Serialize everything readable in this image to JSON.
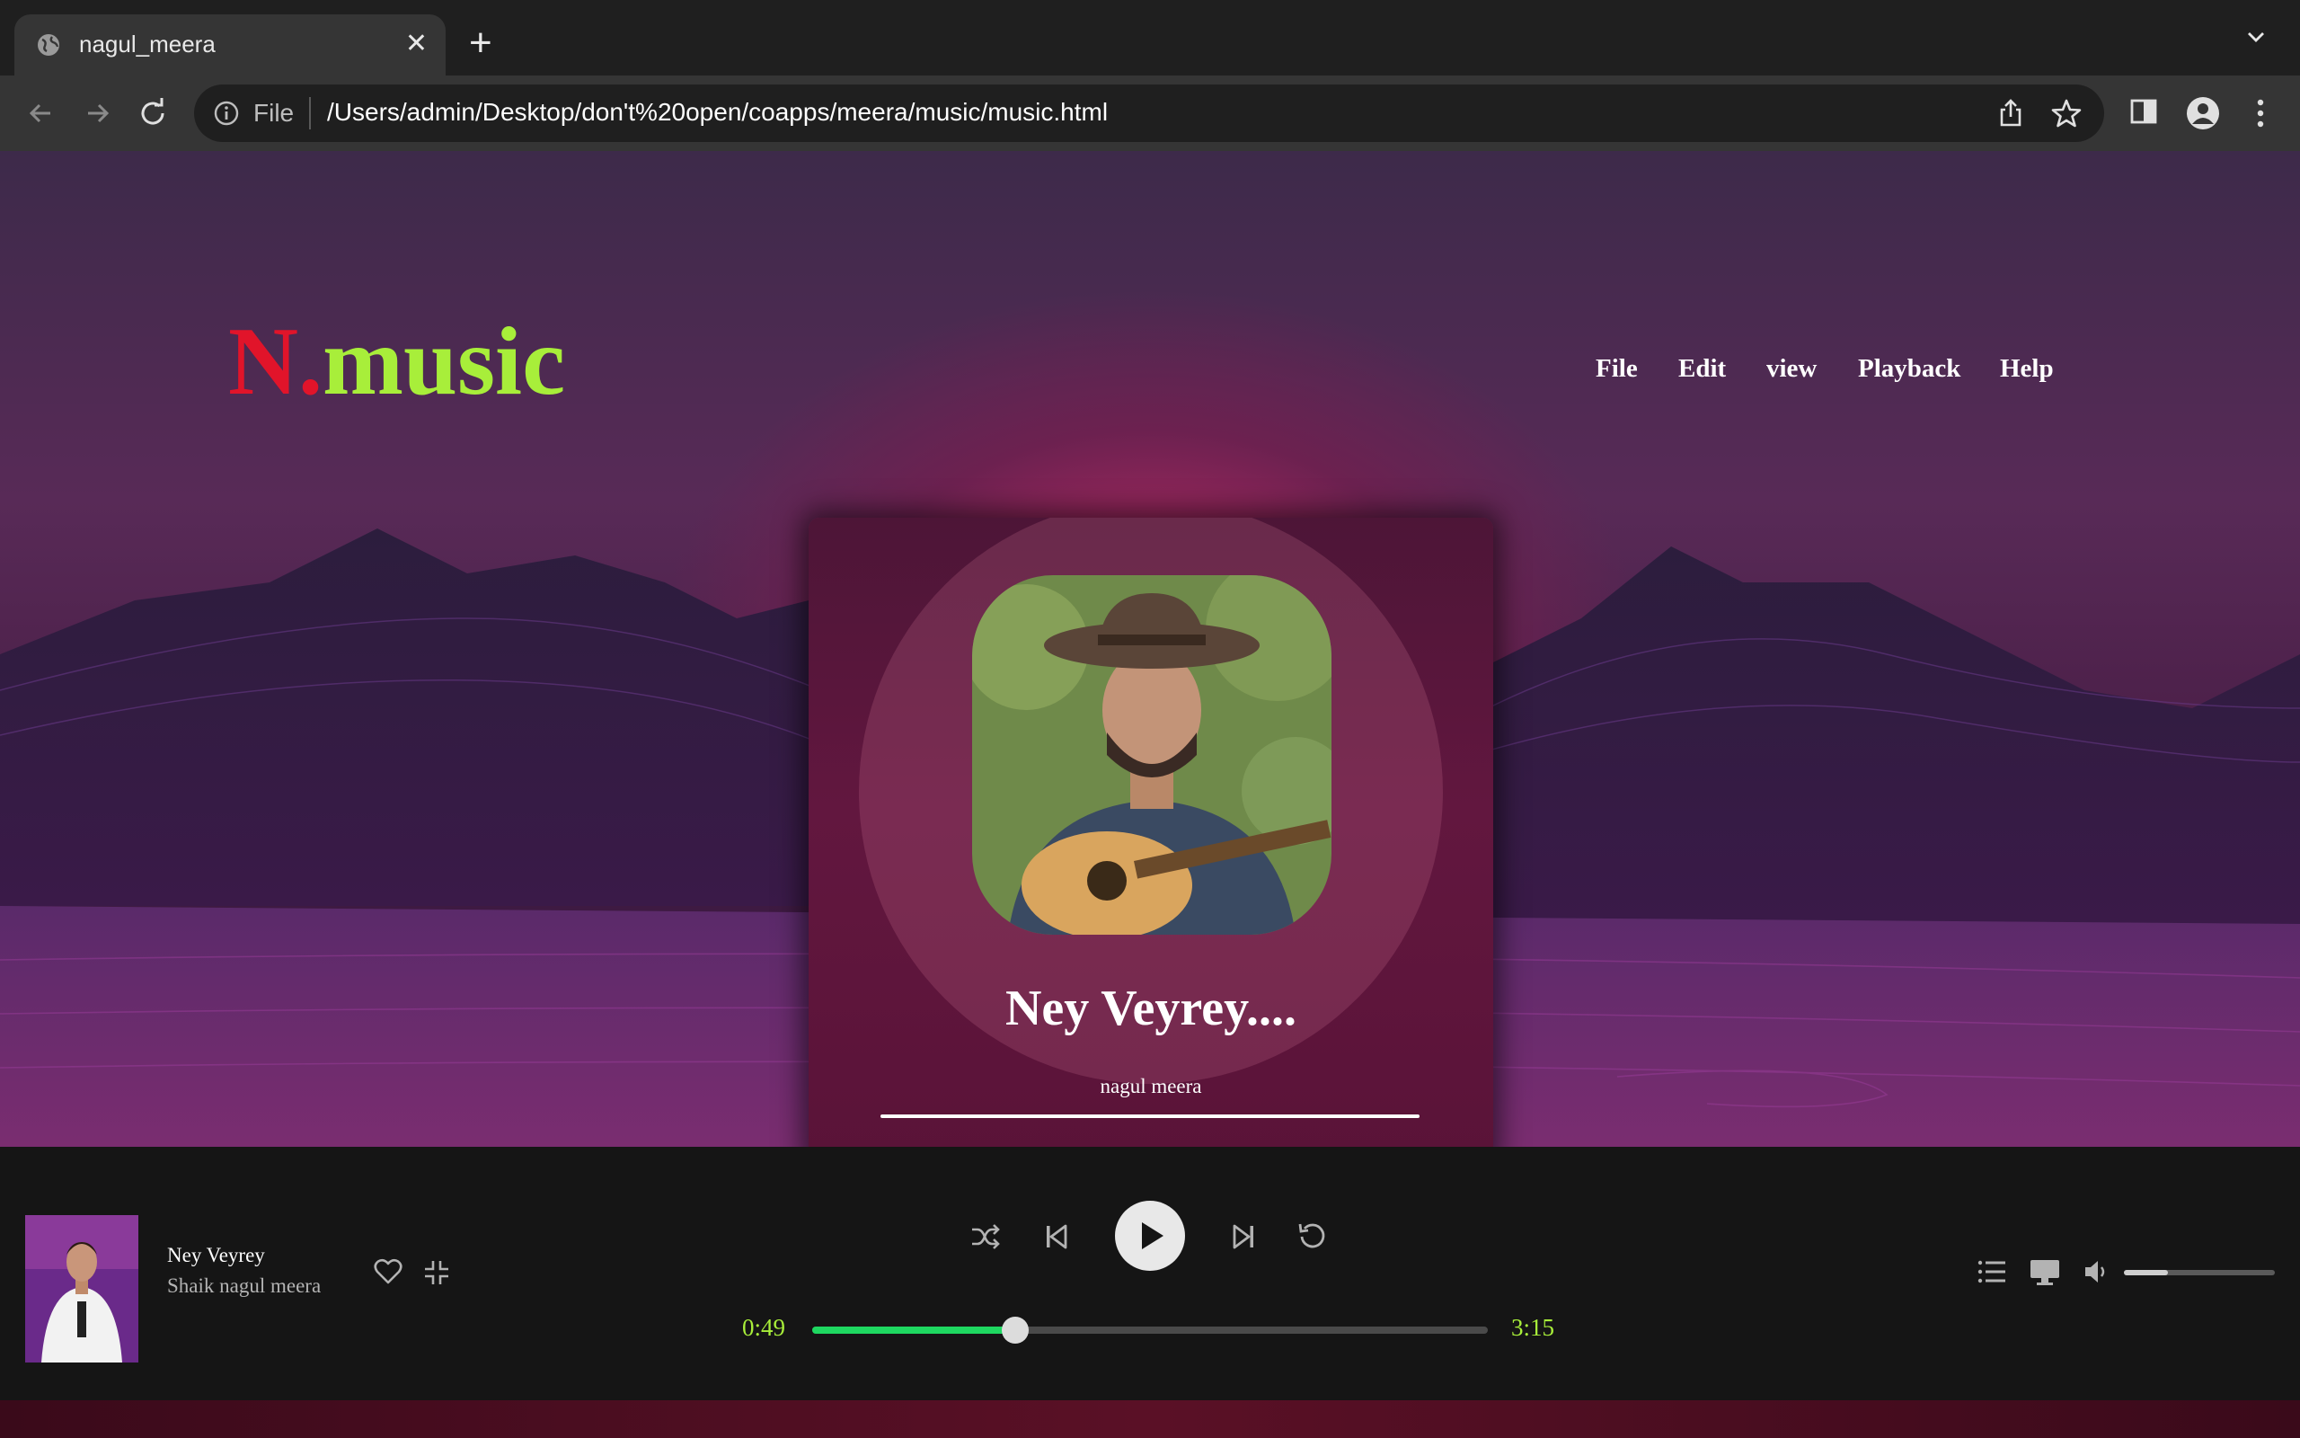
{
  "browser": {
    "tab_title": "nagul_meera",
    "omnibox_scheme": "File",
    "url": "/Users/admin/Desktop/don't%20open/coapps/meera/music/music.html"
  },
  "logo": {
    "n": "N",
    "dot": ".",
    "music": "music"
  },
  "menu": [
    "File",
    "Edit",
    "view",
    "Playback",
    "Help"
  ],
  "card": {
    "title": "Ney Veyrey....",
    "artist": "nagul meera"
  },
  "now_playing": {
    "title": "Ney Veyrey",
    "artist": "Shaik nagul meera"
  },
  "progress": {
    "current": "0:49",
    "total": "3:15",
    "fraction": 0.3
  },
  "volume": {
    "fraction": 0.29
  },
  "colors": {
    "logo_red": "#e1142a",
    "logo_green": "#a8ee3a",
    "progress_green": "#1ed760",
    "time_green": "#a8ee3a"
  },
  "icons": [
    "globe-icon",
    "close-icon",
    "plus-icon",
    "chevron-down-icon",
    "back-icon",
    "forward-icon",
    "reload-icon",
    "info-icon",
    "share-icon",
    "star-icon",
    "side-panel-icon",
    "profile-icon",
    "kebab-menu-icon",
    "heart-icon",
    "minimize-icon",
    "shuffle-icon",
    "previous-icon",
    "play-icon",
    "next-icon",
    "repeat-icon",
    "queue-icon",
    "device-icon",
    "volume-icon"
  ]
}
